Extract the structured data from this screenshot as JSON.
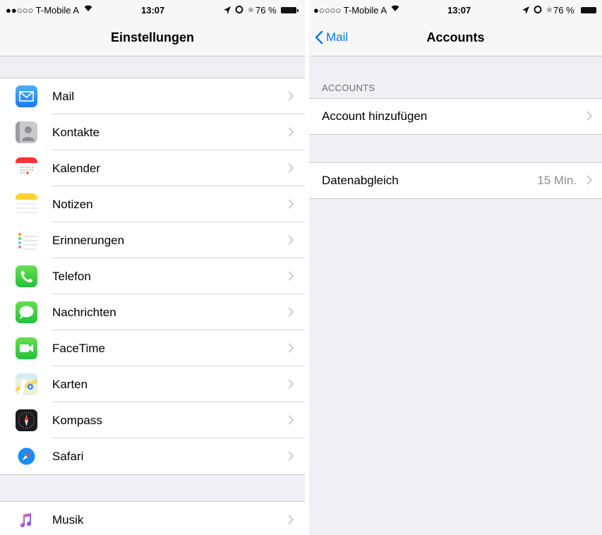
{
  "left_status": {
    "carrier": "●●○○○ T-Mobile A",
    "time": "13:07",
    "battery": "76 %"
  },
  "left_nav": {
    "title": "Einstellungen"
  },
  "settings_group1": [
    {
      "label": "Mail",
      "icon": "mail-icon"
    },
    {
      "label": "Kontakte",
      "icon": "contacts-icon"
    },
    {
      "label": "Kalender",
      "icon": "calendar-icon"
    },
    {
      "label": "Notizen",
      "icon": "notes-icon"
    },
    {
      "label": "Erinnerungen",
      "icon": "reminders-icon"
    },
    {
      "label": "Telefon",
      "icon": "phone-icon"
    },
    {
      "label": "Nachrichten",
      "icon": "messages-icon"
    },
    {
      "label": "FaceTime",
      "icon": "facetime-icon"
    },
    {
      "label": "Karten",
      "icon": "maps-icon"
    },
    {
      "label": "Kompass",
      "icon": "compass-icon"
    },
    {
      "label": "Safari",
      "icon": "safari-icon"
    }
  ],
  "settings_group2": [
    {
      "label": "Musik",
      "icon": "music-icon"
    }
  ],
  "right_status": {
    "carrier": "●○○○○ T-Mobile A",
    "time": "13:07",
    "battery": "76 %"
  },
  "right_nav": {
    "back_label": "Mail",
    "title": "Accounts"
  },
  "accounts": {
    "section_header": "ACCOUNTS",
    "add_account": "Account hinzufügen",
    "fetch_label": "Datenabgleich",
    "fetch_value": "15 Min."
  },
  "colors": {
    "accent": "#007aff",
    "background": "#efeff4"
  }
}
